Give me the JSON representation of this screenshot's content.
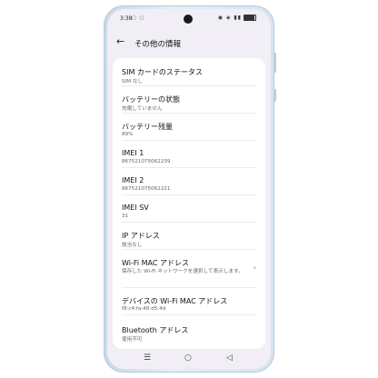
{
  "status": {
    "time": "3:38",
    "left_icons": "▢ ▢",
    "right_icons": "◉ ◈ ▮▮",
    "battery_level": 0.89
  },
  "appbar": {
    "back_icon": "←",
    "title": "その他の情報"
  },
  "items": [
    {
      "title": "SIM カードのステータス",
      "value": "SIM なし"
    },
    {
      "title": "バッテリーの状態",
      "value": "充電していません"
    },
    {
      "title": "バッテリー残量",
      "value": "89%"
    },
    {
      "title": "IMEI 1",
      "value": "867521075062239"
    },
    {
      "title": "IMEI 2",
      "value": "867521075062221"
    },
    {
      "title": "IMEI SV",
      "value": "31"
    },
    {
      "title": "IP アドレス",
      "value": "該当なし"
    },
    {
      "title": "Wi-Fi MAC アドレス",
      "value": "保存した Wi-Fi ネットワークを選択して表示します。",
      "chevron": "›"
    },
    {
      "title": "デバイスの Wi-Fi MAC アドレス",
      "value": "f8:c4:fa:48:d5:4d"
    },
    {
      "title": "Bluetooth アドレス",
      "value": "使用不可"
    }
  ],
  "navbar": {
    "menu_icon": "☰",
    "home_icon": "○",
    "back_icon": "◁"
  }
}
